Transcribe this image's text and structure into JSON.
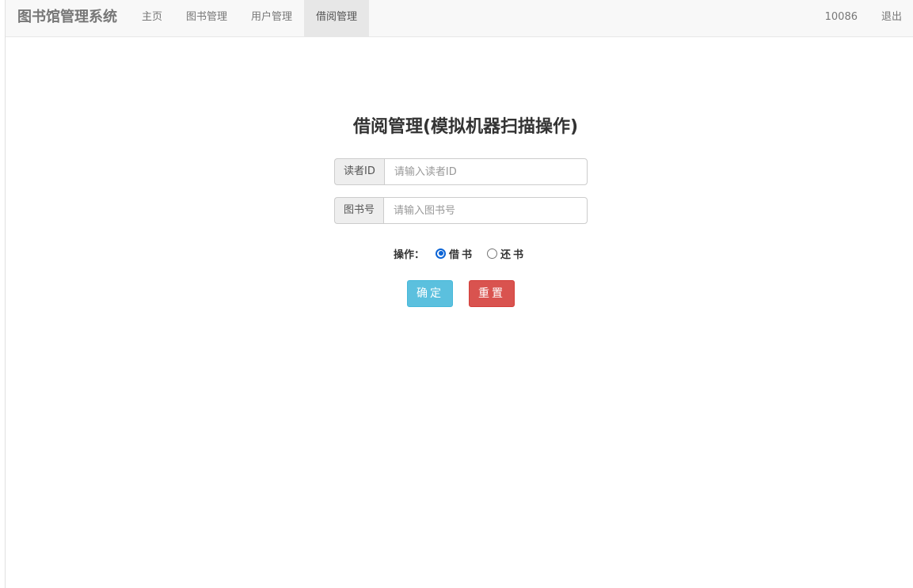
{
  "navbar": {
    "brand": "图书馆管理系统",
    "items": [
      {
        "label": "主页",
        "active": false
      },
      {
        "label": "图书管理",
        "active": false
      },
      {
        "label": "用户管理",
        "active": false
      },
      {
        "label": "借阅管理",
        "active": true
      }
    ],
    "user": "10086",
    "logout": "退出"
  },
  "main": {
    "title": "借阅管理(模拟机器扫描操作)",
    "reader_field": {
      "label": "读者ID",
      "placeholder": "请输入读者ID",
      "value": ""
    },
    "book_field": {
      "label": "图书号",
      "placeholder": "请输入图书号",
      "value": ""
    },
    "operation": {
      "label": "操作：",
      "options": [
        {
          "label": "借书",
          "checked": true
        },
        {
          "label": "还书",
          "checked": false
        }
      ]
    },
    "confirm_button": "确定",
    "reset_button": "重置"
  },
  "colors": {
    "navbar_bg": "#f8f8f8",
    "active_tab_bg": "#e7e7e7",
    "confirm": "#5bc0de",
    "reset": "#d9534f",
    "radio_accent": "#0b64d6"
  }
}
